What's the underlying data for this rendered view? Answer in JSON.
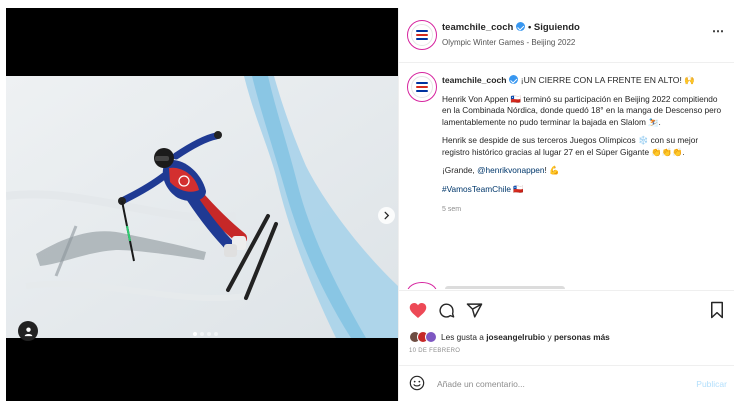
{
  "post": {
    "username": "teamchile_coch",
    "follow_separator": "•",
    "follow_label": "Siguiendo",
    "location": "Olympic Winter Games - Beijing 2022",
    "more_icon": "⋯",
    "brand_colors": {
      "ring": "#d6249f",
      "verified": "#3897f0",
      "heart": "#ed4956",
      "link": "#00376b",
      "publish": "#b2dffc"
    }
  },
  "caption": {
    "username": "teamchile_coch",
    "headline": "¡UN CIERRE CON LA FRENTE EN ALTO! 🙌",
    "paragraph1": "Henrik Von Appen 🇨🇱 terminó su participación en Beijing 2022 compitiendo en la Combinada Nórdica, donde quedó 18° en la manga de Descenso pero lamentablemente no pudo terminar la bajada en Slalom ⛷️.",
    "paragraph2": "Henrik se despide de sus terceros Juegos Olímpicos ❄️ con su mejor registro histórico gracias al lugar 27 en el Súper Gigante 👏👏👏.",
    "p3_prefix": "¡Grande, ",
    "mention": "@henrikvonappen",
    "p3_suffix": "! 💪",
    "hashtag": "#VamosTeamChile",
    "hashtag_suffix": " 🇨🇱",
    "time": "5 sem"
  },
  "actions": {
    "icons": [
      "heart-icon",
      "comment-icon",
      "share-icon",
      "bookmark-icon"
    ],
    "likes_prefix": "Les gusta a ",
    "likes_user": "joseangelrubio",
    "likes_mid": " y ",
    "likes_more": "personas más",
    "date": "10 DE FEBRERO"
  },
  "comment": {
    "placeholder": "Añade un comentario...",
    "publish_label": "Publicar"
  },
  "media": {
    "carousel_dots": 4,
    "active_dot": 0
  }
}
